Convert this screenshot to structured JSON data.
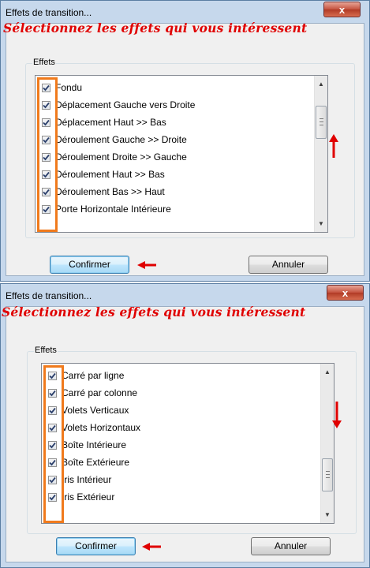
{
  "dialogs": [
    {
      "title": "Effets de transition...",
      "close_label": "x",
      "banner": "Sélectionnez les effets qui vous intéressent",
      "group_label": "Effets",
      "items": [
        {
          "label": "Fondu",
          "checked": true
        },
        {
          "label": "Déplacement Gauche vers Droite",
          "checked": true
        },
        {
          "label": "Déplacement Haut >> Bas",
          "checked": true
        },
        {
          "label": "Déroulement Gauche >> Droite",
          "checked": true
        },
        {
          "label": "Déroulement Droite >> Gauche",
          "checked": true
        },
        {
          "label": "Déroulement Haut >> Bas",
          "checked": true
        },
        {
          "label": "Déroulement Bas >> Haut",
          "checked": true
        },
        {
          "label": "Porte Horizontale Intérieure",
          "checked": true
        }
      ],
      "confirm_label": "Confirmer",
      "cancel_label": "Annuler"
    },
    {
      "title": "Effets de transition...",
      "close_label": "x",
      "banner": "Sélectionnez les effets qui vous intéressent",
      "group_label": "Effets",
      "items": [
        {
          "label": "Carré par ligne",
          "checked": true
        },
        {
          "label": "Carré par colonne",
          "checked": true
        },
        {
          "label": "Volets Verticaux",
          "checked": true
        },
        {
          "label": "Volets Horizontaux",
          "checked": true
        },
        {
          "label": "Boîte Intérieure",
          "checked": true
        },
        {
          "label": "Boîte Extérieure",
          "checked": true
        },
        {
          "label": "Iris Intérieur",
          "checked": true
        },
        {
          "label": "Iris Extérieur",
          "checked": true
        }
      ],
      "confirm_label": "Confirmer",
      "cancel_label": "Annuler"
    }
  ],
  "colors": {
    "annotation_red": "#e00000",
    "highlight_orange": "#f07a1c",
    "window_frame": "#c6d8ec"
  },
  "icons": [
    "close-icon",
    "checkbox-checked-icon",
    "scroll-up-icon",
    "scroll-down-icon",
    "red-arrow-icon"
  ]
}
